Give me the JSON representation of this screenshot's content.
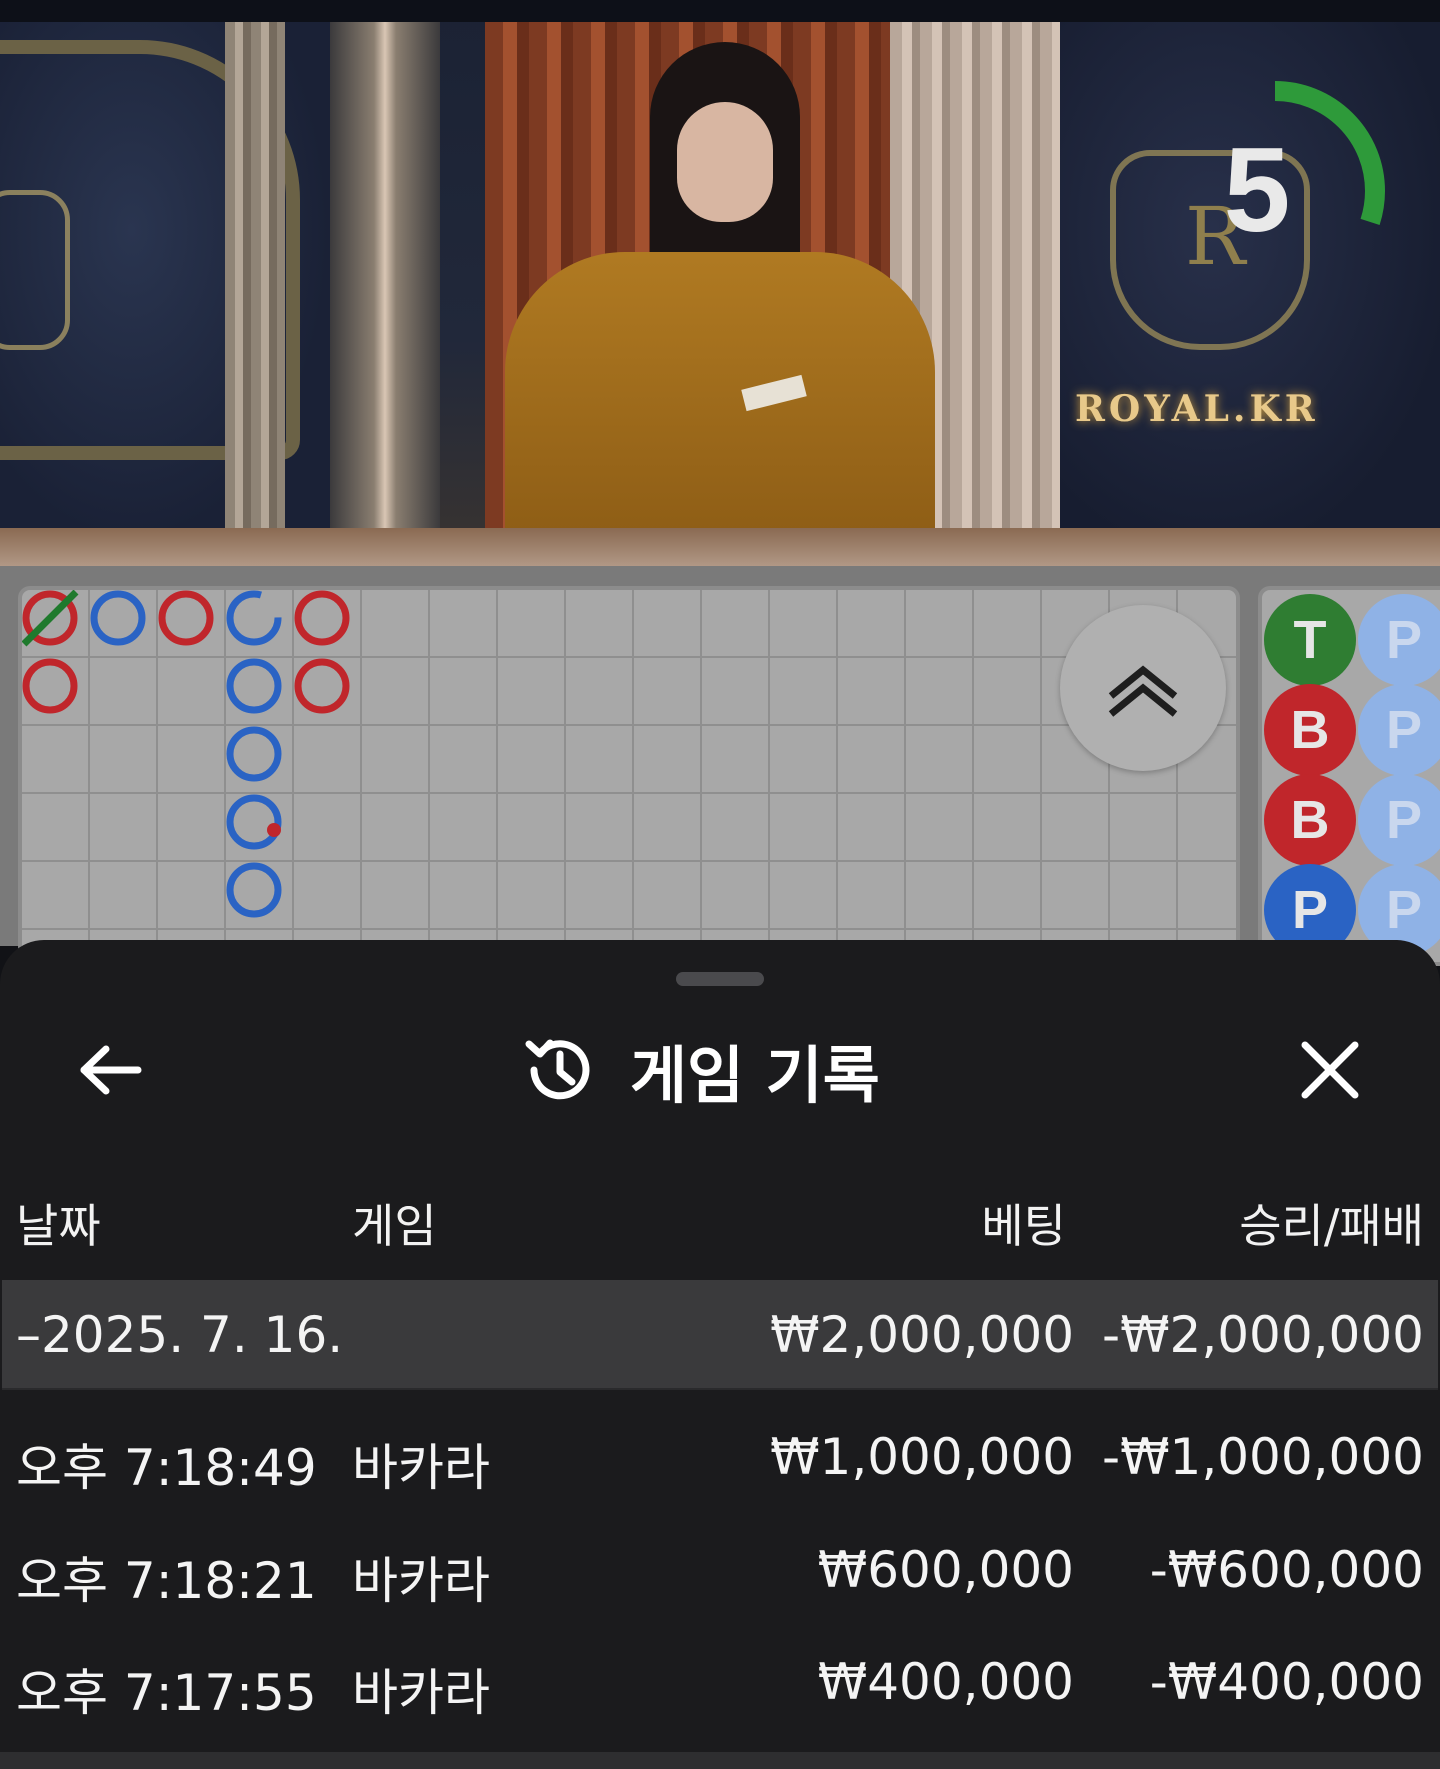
{
  "video": {
    "brand_text": "ROYAL.KR",
    "crest_letter": "R",
    "countdown": "5",
    "countdown_progress": 0.3
  },
  "roadmap": {
    "big_road_cells": [
      {
        "col": 0,
        "row": 0,
        "color": "red",
        "tie_slash": true
      },
      {
        "col": 0,
        "row": 1,
        "color": "red"
      },
      {
        "col": 1,
        "row": 0,
        "color": "blue"
      },
      {
        "col": 2,
        "row": 0,
        "color": "red"
      },
      {
        "col": 3,
        "row": 0,
        "color": "blue",
        "broken": true
      },
      {
        "col": 3,
        "row": 1,
        "color": "blue"
      },
      {
        "col": 3,
        "row": 2,
        "color": "blue"
      },
      {
        "col": 3,
        "row": 3,
        "color": "blue",
        "red_dot": true
      },
      {
        "col": 3,
        "row": 4,
        "color": "blue"
      },
      {
        "col": 4,
        "row": 0,
        "color": "red"
      },
      {
        "col": 4,
        "row": 1,
        "color": "red"
      }
    ],
    "bead_col1": [
      "T",
      "B",
      "B",
      "P"
    ],
    "bead_col2": [
      "P",
      "P",
      "P",
      "P"
    ],
    "colors": {
      "red": "#c0262b",
      "blue": "#2a63c4",
      "green": "#2f7d32",
      "tie": "#1f7a2d"
    }
  },
  "sheet": {
    "title": "게임 기록",
    "back_icon": "arrow-left-icon",
    "history_icon": "history-icon",
    "close_icon": "close-icon"
  },
  "table": {
    "headers": {
      "date": "날짜",
      "game": "게임",
      "bet": "베팅",
      "winloss": "승리/패배"
    },
    "date_group": {
      "date": "–2025. 7. 16.",
      "bet": "₩2,000,000",
      "winloss": "-₩2,000,000"
    },
    "rows": [
      {
        "time": "오후 7:18:49",
        "game": "바카라",
        "bet": "₩1,000,000",
        "winloss": "-₩1,000,000"
      },
      {
        "time": "오후 7:18:21",
        "game": "바카라",
        "bet": "₩600,000",
        "winloss": "-₩600,000"
      },
      {
        "time": "오후 7:17:55",
        "game": "바카라",
        "bet": "₩400,000",
        "winloss": "-₩400,000"
      }
    ]
  }
}
